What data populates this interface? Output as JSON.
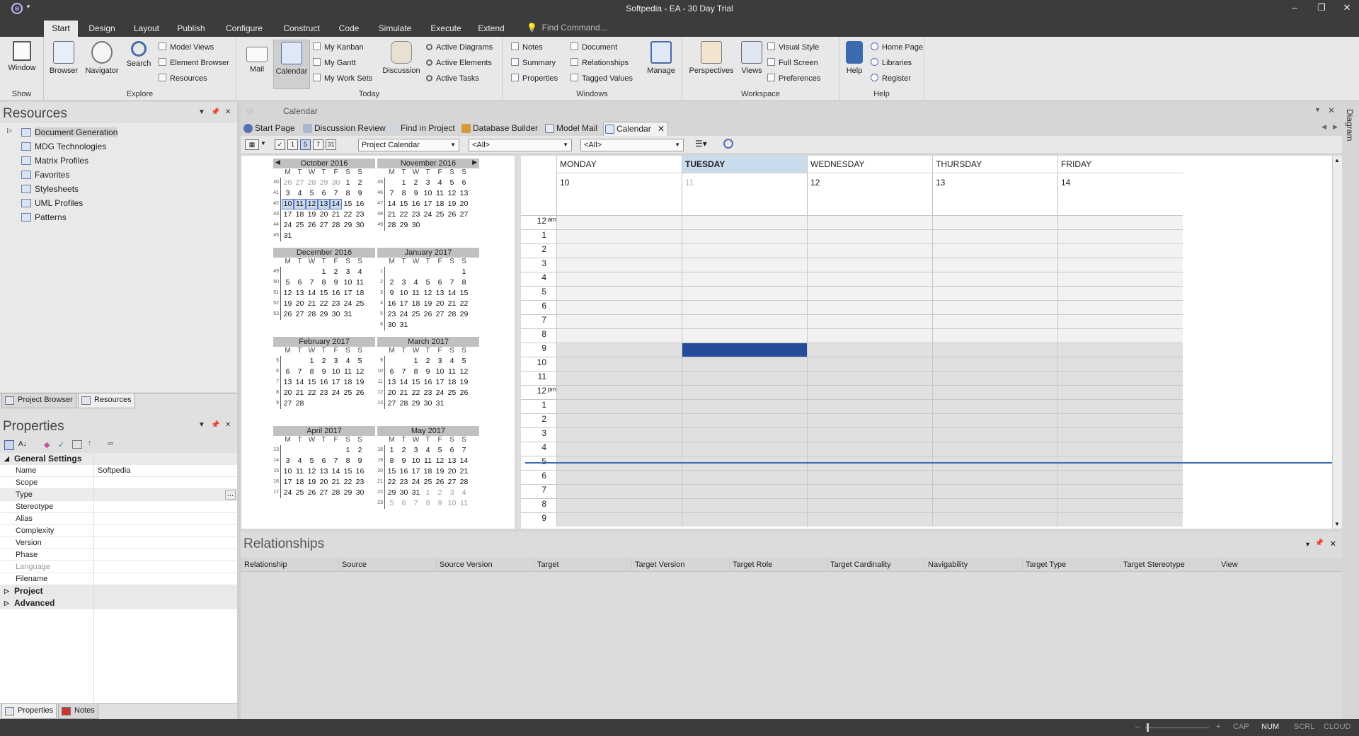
{
  "window": {
    "title": "Softpedia - EA - 30 Day Trial",
    "minimize": "–",
    "restore": "❐",
    "close": "✕"
  },
  "ribbon_tabs": [
    "Start",
    "Design",
    "Layout",
    "Publish",
    "Configure",
    "Construct",
    "Code",
    "Simulate",
    "Execute",
    "Extend"
  ],
  "find_command": "Find Command...",
  "ribbon": {
    "show": {
      "label": "Show",
      "window": "Window"
    },
    "explore": {
      "label": "Explore",
      "browser": "Browser",
      "navigator": "Navigator",
      "search": "Search",
      "items": [
        "Model Views",
        "Element Browser",
        "Resources"
      ]
    },
    "today": {
      "label": "Today",
      "mail": "Mail",
      "calendar": "Calendar",
      "items": [
        "My Kanban",
        "My Gantt",
        "My Work Sets"
      ],
      "discussion": "Discussion",
      "active": [
        "Active Diagrams",
        "Active Elements",
        "Active Tasks"
      ]
    },
    "windows": {
      "label": "Windows",
      "col1": [
        "Notes",
        "Summary",
        "Properties"
      ],
      "col2": [
        "Document",
        "Relationships",
        "Tagged Values"
      ],
      "manage": "Manage"
    },
    "workspace": {
      "label": "Workspace",
      "perspectives": "Perspectives",
      "views": "Views",
      "items": [
        "Visual Style",
        "Full Screen",
        "Preferences"
      ]
    },
    "help": {
      "label": "Help",
      "help": "Help",
      "items": [
        "Home Page",
        "Libraries",
        "Register"
      ]
    }
  },
  "resources": {
    "title": "Resources",
    "items": [
      "Document Generation",
      "MDG Technologies",
      "Matrix Profiles",
      "Favorites",
      "Stylesheets",
      "UML Profiles",
      "Patterns"
    ],
    "tabs": [
      "Project Browser",
      "Resources"
    ]
  },
  "properties": {
    "title": "Properties",
    "general": "General Settings",
    "rows": [
      {
        "name": "Name",
        "value": "Softpedia"
      },
      {
        "name": "Scope",
        "value": ""
      },
      {
        "name": "Type",
        "value": ""
      },
      {
        "name": "Stereotype",
        "value": ""
      },
      {
        "name": "Alias",
        "value": ""
      },
      {
        "name": "Complexity",
        "value": ""
      },
      {
        "name": "Version",
        "value": ""
      },
      {
        "name": "Phase",
        "value": ""
      },
      {
        "name": "Language",
        "value": ""
      },
      {
        "name": "Filename",
        "value": ""
      }
    ],
    "project": "Project",
    "advanced": "Advanced",
    "ellipsis": "...",
    "tabs": [
      "Properties",
      "Notes"
    ]
  },
  "document": {
    "title": "Calendar",
    "tabs": [
      "Start Page",
      "Discussion Review",
      "Find in Project",
      "Database Builder",
      "Model Mail",
      "Calendar"
    ],
    "tab_close": "✕",
    "combo_calendar": "Project Calendar",
    "combo_a": "<All>",
    "combo_b": "<All>",
    "view_buttons": [
      "1",
      "5",
      "7",
      "31"
    ]
  },
  "dow_letters": [
    "M",
    "T",
    "W",
    "T",
    "F",
    "S",
    "S"
  ],
  "months": [
    {
      "title": "October 2016",
      "weeks": [
        {
          "n": "40",
          "d": [
            "26",
            "27",
            "28",
            "29",
            "30",
            "1",
            "2"
          ],
          "o": [
            0,
            1,
            2,
            3,
            4
          ]
        },
        {
          "n": "41",
          "d": [
            "3",
            "4",
            "5",
            "6",
            "7",
            "8",
            "9"
          ]
        },
        {
          "n": "42",
          "d": [
            "10",
            "11",
            "12",
            "13",
            "14",
            "15",
            "16"
          ],
          "s": [
            0,
            1,
            2,
            3,
            4
          ]
        },
        {
          "n": "43",
          "d": [
            "17",
            "18",
            "19",
            "20",
            "21",
            "22",
            "23"
          ]
        },
        {
          "n": "44",
          "d": [
            "24",
            "25",
            "26",
            "27",
            "28",
            "29",
            "30"
          ]
        },
        {
          "n": "45",
          "d": [
            "31",
            "",
            "",
            "",
            "",
            "",
            ""
          ]
        }
      ]
    },
    {
      "title": "November 2016",
      "weeks": [
        {
          "n": "45",
          "d": [
            "",
            "1",
            "2",
            "3",
            "4",
            "5",
            "6"
          ]
        },
        {
          "n": "46",
          "d": [
            "7",
            "8",
            "9",
            "10",
            "11",
            "12",
            "13"
          ]
        },
        {
          "n": "47",
          "d": [
            "14",
            "15",
            "16",
            "17",
            "18",
            "19",
            "20"
          ]
        },
        {
          "n": "48",
          "d": [
            "21",
            "22",
            "23",
            "24",
            "25",
            "26",
            "27"
          ]
        },
        {
          "n": "49",
          "d": [
            "28",
            "29",
            "30",
            "",
            "",
            "",
            ""
          ]
        }
      ]
    },
    {
      "title": "December 2016",
      "weeks": [
        {
          "n": "49",
          "d": [
            "",
            "",
            "",
            "1",
            "2",
            "3",
            "4"
          ]
        },
        {
          "n": "50",
          "d": [
            "5",
            "6",
            "7",
            "8",
            "9",
            "10",
            "11"
          ]
        },
        {
          "n": "51",
          "d": [
            "12",
            "13",
            "14",
            "15",
            "16",
            "17",
            "18"
          ]
        },
        {
          "n": "52",
          "d": [
            "19",
            "20",
            "21",
            "22",
            "23",
            "24",
            "25"
          ]
        },
        {
          "n": "53",
          "d": [
            "26",
            "27",
            "28",
            "29",
            "30",
            "31",
            ""
          ]
        }
      ]
    },
    {
      "title": "January 2017",
      "weeks": [
        {
          "n": "1",
          "d": [
            "",
            "",
            "",
            "",
            "",
            "",
            "1"
          ]
        },
        {
          "n": "2",
          "d": [
            "2",
            "3",
            "4",
            "5",
            "6",
            "7",
            "8"
          ]
        },
        {
          "n": "3",
          "d": [
            "9",
            "10",
            "11",
            "12",
            "13",
            "14",
            "15"
          ]
        },
        {
          "n": "4",
          "d": [
            "16",
            "17",
            "18",
            "19",
            "20",
            "21",
            "22"
          ]
        },
        {
          "n": "5",
          "d": [
            "23",
            "24",
            "25",
            "26",
            "27",
            "28",
            "29"
          ]
        },
        {
          "n": "6",
          "d": [
            "30",
            "31",
            "",
            "",
            "",
            "",
            ""
          ]
        }
      ]
    },
    {
      "title": "February 2017",
      "weeks": [
        {
          "n": "5",
          "d": [
            "",
            "",
            "1",
            "2",
            "3",
            "4",
            "5"
          ]
        },
        {
          "n": "6",
          "d": [
            "6",
            "7",
            "8",
            "9",
            "10",
            "11",
            "12"
          ]
        },
        {
          "n": "7",
          "d": [
            "13",
            "14",
            "15",
            "16",
            "17",
            "18",
            "19"
          ]
        },
        {
          "n": "8",
          "d": [
            "20",
            "21",
            "22",
            "23",
            "24",
            "25",
            "26"
          ]
        },
        {
          "n": "9",
          "d": [
            "27",
            "28",
            "",
            "",
            "",
            "",
            ""
          ]
        }
      ]
    },
    {
      "title": "March 2017",
      "weeks": [
        {
          "n": "9",
          "d": [
            "",
            "",
            "1",
            "2",
            "3",
            "4",
            "5"
          ]
        },
        {
          "n": "10",
          "d": [
            "6",
            "7",
            "8",
            "9",
            "10",
            "11",
            "12"
          ]
        },
        {
          "n": "11",
          "d": [
            "13",
            "14",
            "15",
            "16",
            "17",
            "18",
            "19"
          ]
        },
        {
          "n": "12",
          "d": [
            "20",
            "21",
            "22",
            "23",
            "24",
            "25",
            "26"
          ]
        },
        {
          "n": "13",
          "d": [
            "27",
            "28",
            "29",
            "30",
            "31",
            "",
            ""
          ]
        }
      ]
    },
    {
      "title": "April 2017",
      "weeks": [
        {
          "n": "13",
          "d": [
            "",
            "",
            "",
            "",
            "",
            "1",
            "2"
          ]
        },
        {
          "n": "14",
          "d": [
            "3",
            "4",
            "5",
            "6",
            "7",
            "8",
            "9"
          ]
        },
        {
          "n": "15",
          "d": [
            "10",
            "11",
            "12",
            "13",
            "14",
            "15",
            "16"
          ]
        },
        {
          "n": "16",
          "d": [
            "17",
            "18",
            "19",
            "20",
            "21",
            "22",
            "23"
          ]
        },
        {
          "n": "17",
          "d": [
            "24",
            "25",
            "26",
            "27",
            "28",
            "29",
            "30"
          ]
        }
      ]
    },
    {
      "title": "May 2017",
      "weeks": [
        {
          "n": "18",
          "d": [
            "1",
            "2",
            "3",
            "4",
            "5",
            "6",
            "7"
          ]
        },
        {
          "n": "19",
          "d": [
            "8",
            "9",
            "10",
            "11",
            "12",
            "13",
            "14"
          ]
        },
        {
          "n": "20",
          "d": [
            "15",
            "16",
            "17",
            "18",
            "19",
            "20",
            "21"
          ]
        },
        {
          "n": "21",
          "d": [
            "22",
            "23",
            "24",
            "25",
            "26",
            "27",
            "28"
          ]
        },
        {
          "n": "22",
          "d": [
            "29",
            "30",
            "31",
            "1",
            "2",
            "3",
            "4"
          ],
          "o": [
            3,
            4,
            5,
            6
          ]
        },
        {
          "n": "23",
          "d": [
            "5",
            "6",
            "7",
            "8",
            "9",
            "10",
            "11"
          ],
          "o": [
            0,
            1,
            2,
            3,
            4,
            5,
            6
          ]
        }
      ]
    }
  ],
  "week": {
    "days": [
      {
        "name": "MONDAY",
        "num": "10"
      },
      {
        "name": "TUESDAY",
        "num": "11",
        "today": true
      },
      {
        "name": "WEDNESDAY",
        "num": "12"
      },
      {
        "name": "THURSDAY",
        "num": "13"
      },
      {
        "name": "FRIDAY",
        "num": "14"
      }
    ],
    "hours": [
      "12",
      "1",
      "2",
      "3",
      "4",
      "5",
      "6",
      "7",
      "8",
      "9",
      "10",
      "11",
      "12",
      "1",
      "2",
      "3",
      "4",
      "5",
      "6",
      "7",
      "8",
      "9"
    ],
    "am": "am",
    "pm": "pm",
    "selected_day": 1,
    "selected_hour": 9
  },
  "relationships": {
    "title": "Relationships",
    "columns": [
      "Relationship",
      "Source",
      "Source Version",
      "Target",
      "Target Version",
      "Target Role",
      "Target Cardinality",
      "Navigability",
      "Target Type",
      "Target Stereotype",
      "View"
    ]
  },
  "side_strip": "Diagram",
  "status": {
    "zoom_minus": "–",
    "zoom_plus": "+",
    "caps": "CAP",
    "num": "NUM",
    "scrl": "SCRL",
    "cloud": "CLOUD"
  }
}
